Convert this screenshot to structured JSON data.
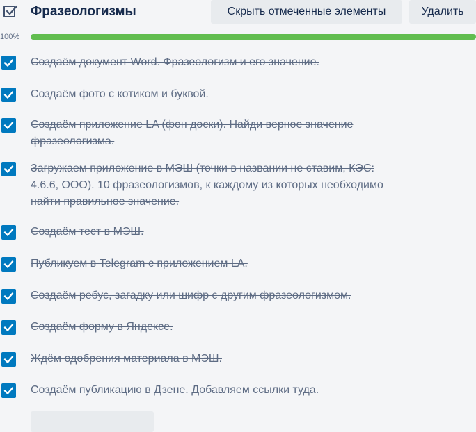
{
  "checklist": {
    "title": "Фразеологизмы",
    "hide_checked_label": "Скрыть отмеченные элементы",
    "delete_label": "Удалить",
    "progress_text": "100%",
    "progress": 1.0,
    "items": [
      {
        "text": "Создаём документ Word. Фразеологизм и его значение.",
        "checked": true
      },
      {
        "text": "Создаём фото с котиком и буквой.",
        "checked": true
      },
      {
        "text": "Создаём приложение LA (фон доски). Найди верное значение фразеологизма.",
        "checked": true
      },
      {
        "text": "Загружаем приложение в МЭШ (точки в названии не ставим, КЭС: 4.6.6, ООО). 10 фразеологизмов, к каждому из которых необходимо найти правильное значение.",
        "checked": true
      },
      {
        "text": "Создаём тест в МЭШ.",
        "checked": true
      },
      {
        "text": "Публикуем в Telegram с приложением LA.",
        "checked": true
      },
      {
        "text": "Создаём ребус, загадку или шифр с другим фразеологизмом.",
        "checked": true
      },
      {
        "text": "Создаём форму в Яндексе.",
        "checked": true
      },
      {
        "text": "Ждём одобрения материала в МЭШ.",
        "checked": true
      },
      {
        "text": "Создаём публикацию в Дзене. Добавляем ссылки туда.",
        "checked": true
      }
    ]
  },
  "colors": {
    "checkbox": "#0079bf",
    "progress_fill": "#61bd4f",
    "text_done": "#5e6c84"
  },
  "icons": {
    "header": "checklist-icon",
    "checkbox": "checkmark-icon"
  }
}
